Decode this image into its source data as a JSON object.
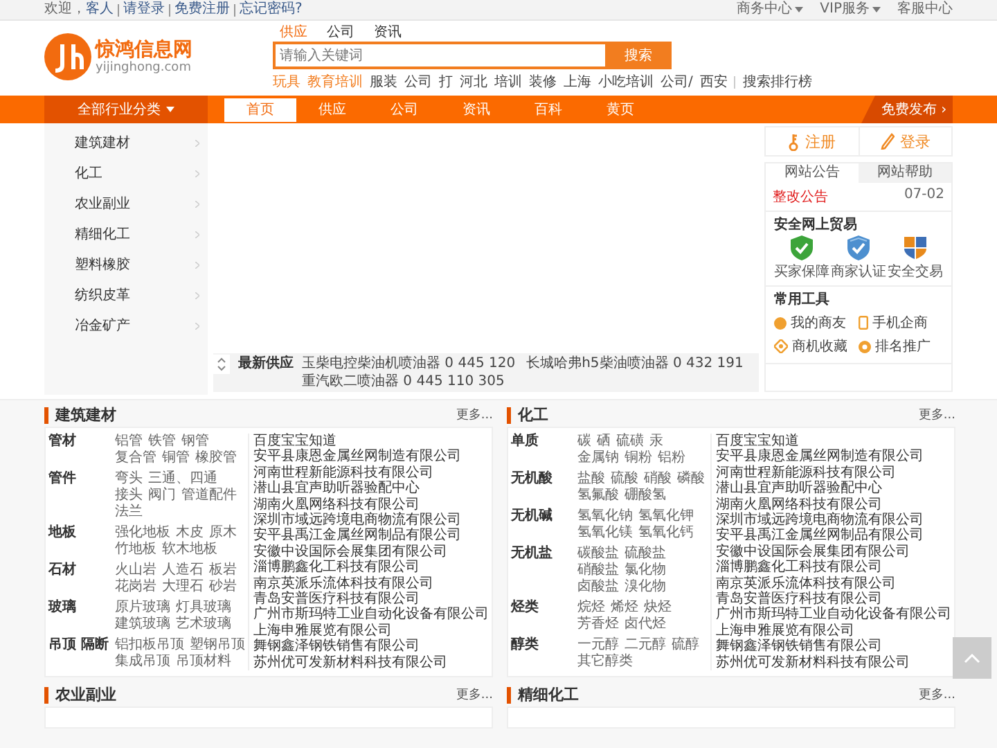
{
  "top_bar": {
    "greeting": "欢迎，",
    "guest": "客人",
    "links": [
      "请登录",
      "免费注册",
      "忘记密码?"
    ],
    "menus": [
      {
        "label": "商务中心",
        "dropdown": true
      },
      {
        "label": "VIP服务",
        "dropdown": true
      },
      {
        "label": "客服中心",
        "dropdown": false
      }
    ]
  },
  "logo": {
    "name": "惊鸿信息网",
    "domain": "yijinghong.com"
  },
  "search": {
    "tabs": [
      {
        "label": "供应",
        "selected": true
      },
      {
        "label": "公司",
        "selected": false
      },
      {
        "label": "资讯",
        "selected": false
      }
    ],
    "placeholder": "请输入关键词",
    "button": "搜索",
    "hot_words": [
      {
        "label": "玩具",
        "highlighted": true
      },
      {
        "label": "教育培训",
        "highlighted": true
      },
      {
        "label": "服装",
        "highlighted": false
      },
      {
        "label": "公司",
        "highlighted": false
      },
      {
        "label": "打",
        "highlighted": false
      },
      {
        "label": "河北",
        "highlighted": false
      },
      {
        "label": "培训",
        "highlighted": false
      },
      {
        "label": "装修",
        "highlighted": false
      },
      {
        "label": "上海",
        "highlighted": false
      },
      {
        "label": "小吃培训",
        "highlighted": false
      },
      {
        "label": "公司/",
        "highlighted": false
      },
      {
        "label": "西安",
        "highlighted": false
      }
    ],
    "ranking_link": "搜索排行榜"
  },
  "nav": {
    "category_button": "全部行业分类",
    "tabs": [
      {
        "label": "首页",
        "selected": true
      },
      {
        "label": "供应",
        "selected": false
      },
      {
        "label": "公司",
        "selected": false
      },
      {
        "label": "资讯",
        "selected": false
      },
      {
        "label": "百科",
        "selected": false
      },
      {
        "label": "黄页",
        "selected": false
      }
    ],
    "publish_button": "免费发布",
    "publish_arrow": "›"
  },
  "sidebar": {
    "items": [
      "建筑建材",
      "化工",
      "农业副业",
      "精细化工",
      "塑料橡胶",
      "纺织皮革",
      "冶金矿产"
    ]
  },
  "ticker": {
    "label": "最新供应",
    "items": [
      "玉柴电控柴油机喷油器 0 445 120",
      "长城哈弗h5柴油喷油器 0 432 191",
      "重汽欧二喷油器 0 445 110 305"
    ]
  },
  "account": {
    "register": "注册",
    "login": "登录"
  },
  "notice": {
    "tabs": [
      {
        "label": "网站公告",
        "selected": true
      },
      {
        "label": "网站帮助",
        "selected": false
      }
    ],
    "items": [
      {
        "title": "整改公告",
        "date": "07-02"
      }
    ]
  },
  "trade": {
    "title": "安全网上贸易",
    "items": [
      {
        "label": "买家保障",
        "kind": "green"
      },
      {
        "label": "商家认证",
        "kind": "blue"
      },
      {
        "label": "安全交易",
        "kind": "quad"
      }
    ]
  },
  "tools": {
    "title": "常用工具",
    "items": [
      {
        "label": "我的商友",
        "kind": "dot"
      },
      {
        "label": "手机企商",
        "kind": "phone"
      },
      {
        "label": "商机收藏",
        "kind": "diamond"
      },
      {
        "label": "排名推广",
        "kind": "badge"
      }
    ]
  },
  "sections": [
    {
      "title": "建筑建材",
      "more": "更多...",
      "groups": [
        {
          "name": "管材",
          "items": [
            "铝管",
            "铁管",
            "钢管",
            "复合管",
            "铜管",
            "橡胶管"
          ]
        },
        {
          "name": "管件",
          "items": [
            "弯头",
            "三通、四通",
            "接头",
            "阀门",
            "管道配件",
            "法兰"
          ]
        },
        {
          "name": "地板",
          "items": [
            "强化地板",
            "木皮",
            "原木",
            "竹地板",
            "软木地板"
          ]
        },
        {
          "name": "石材",
          "items": [
            "火山岩",
            "人造石",
            "板岩",
            "花岗岩",
            "大理石",
            "砂岩"
          ]
        },
        {
          "name": "玻璃",
          "items": [
            "原片玻璃",
            "灯具玻璃",
            "建筑玻璃",
            "艺术玻璃"
          ]
        },
        {
          "name": "吊顶 隔断",
          "items": [
            "铝扣板吊顶",
            "塑钢吊顶",
            "集成吊顶",
            "吊顶材料"
          ]
        }
      ],
      "companies": [
        "百度宝宝知道",
        "安平县康恩金属丝网制造有限公司",
        "河南世程新能源科技有限公司",
        "潜山县宜声助听器验配中心",
        "湖南火凰网络科技有限公司",
        "深圳市域远跨境电商物流有限公司",
        "安平县禹江金属丝网制品有限公司",
        "安徽中设国际会展集团有限公司",
        "淄博鹏鑫化工科技有限公司",
        "南京英派乐流体科技有限公司",
        "青岛安普医疗科技有限公司",
        "广州市斯玛特工业自动化设备有限公司",
        "上海申雅展览有限公司",
        "舞钢鑫泽钢铁销售有限公司",
        "苏州优可发新材料科技有限公司"
      ]
    },
    {
      "title": "化工",
      "more": "更多...",
      "groups": [
        {
          "name": "单质",
          "items": [
            "碳",
            "硒",
            "硫磺",
            "汞",
            "金属钠",
            "铜粉",
            "铝粉"
          ]
        },
        {
          "name": "无机酸",
          "items": [
            "盐酸",
            "硫酸",
            "硝酸",
            "磷酸",
            "氢氟酸",
            "硼酸氢"
          ]
        },
        {
          "name": "无机碱",
          "items": [
            "氢氧化钠",
            "氢氧化钾",
            "氢氧化镁",
            "氢氧化钙"
          ]
        },
        {
          "name": "无机盐",
          "items": [
            "碳酸盐",
            "硫酸盐",
            "硝酸盐",
            "氯化物",
            "卤酸盐",
            "溴化物"
          ]
        },
        {
          "name": "烃类",
          "items": [
            "烷烃",
            "烯烃",
            "炔烃",
            "芳香烃",
            "卤代烃"
          ]
        },
        {
          "name": "醇类",
          "items": [
            "一元醇",
            "二元醇",
            "硫醇",
            "其它醇类"
          ]
        }
      ],
      "companies": [
        "百度宝宝知道",
        "安平县康恩金属丝网制造有限公司",
        "河南世程新能源科技有限公司",
        "潜山县宜声助听器验配中心",
        "湖南火凰网络科技有限公司",
        "深圳市域远跨境电商物流有限公司",
        "安平县禹江金属丝网制品有限公司",
        "安徽中设国际会展集团有限公司",
        "淄博鹏鑫化工科技有限公司",
        "南京英派乐流体科技有限公司",
        "青岛安普医疗科技有限公司",
        "广州市斯玛特工业自动化设备有限公司",
        "上海申雅展览有限公司",
        "舞钢鑫泽钢铁销售有限公司",
        "苏州优可发新材料科技有限公司"
      ]
    },
    {
      "title": "农业副业",
      "more": "更多..."
    },
    {
      "title": "精细化工",
      "more": "更多..."
    }
  ]
}
